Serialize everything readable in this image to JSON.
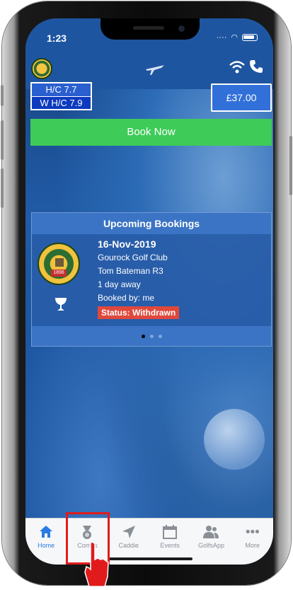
{
  "status_bar": {
    "time": "1:23"
  },
  "handicap": {
    "hc": "H/C 7.7",
    "whc": "W H/C 7.9"
  },
  "balance": "£37.00",
  "book_label": "Book Now",
  "bookings": {
    "heading": "Upcoming Bookings",
    "items": [
      {
        "date": "16-Nov-2019",
        "club": "Gourock Golf Club",
        "member": "Tom Bateman R3",
        "away": "1 day away",
        "booked_by": "Booked by: me",
        "status": "Status: Withdrawn",
        "logo_text": "1896"
      }
    ],
    "page_count": 3,
    "current_page": 1
  },
  "tabs": [
    {
      "label": "Home",
      "icon": "home-icon",
      "active": true
    },
    {
      "label": "Comps",
      "icon": "medal-icon",
      "active": false
    },
    {
      "label": "Caddie",
      "icon": "navigation-arrow-icon",
      "active": false
    },
    {
      "label": "Events",
      "icon": "calendar-icon",
      "active": false
    },
    {
      "label": "GolfsApp",
      "icon": "people-icon",
      "active": false
    },
    {
      "label": "More",
      "icon": "more-icon",
      "active": false
    }
  ],
  "colors": {
    "app_blue": "#1e55a0",
    "book_green": "#3ecb58",
    "status_red": "#e0483c",
    "tab_active": "#2a7be4",
    "highlight": "#e11b1b"
  }
}
